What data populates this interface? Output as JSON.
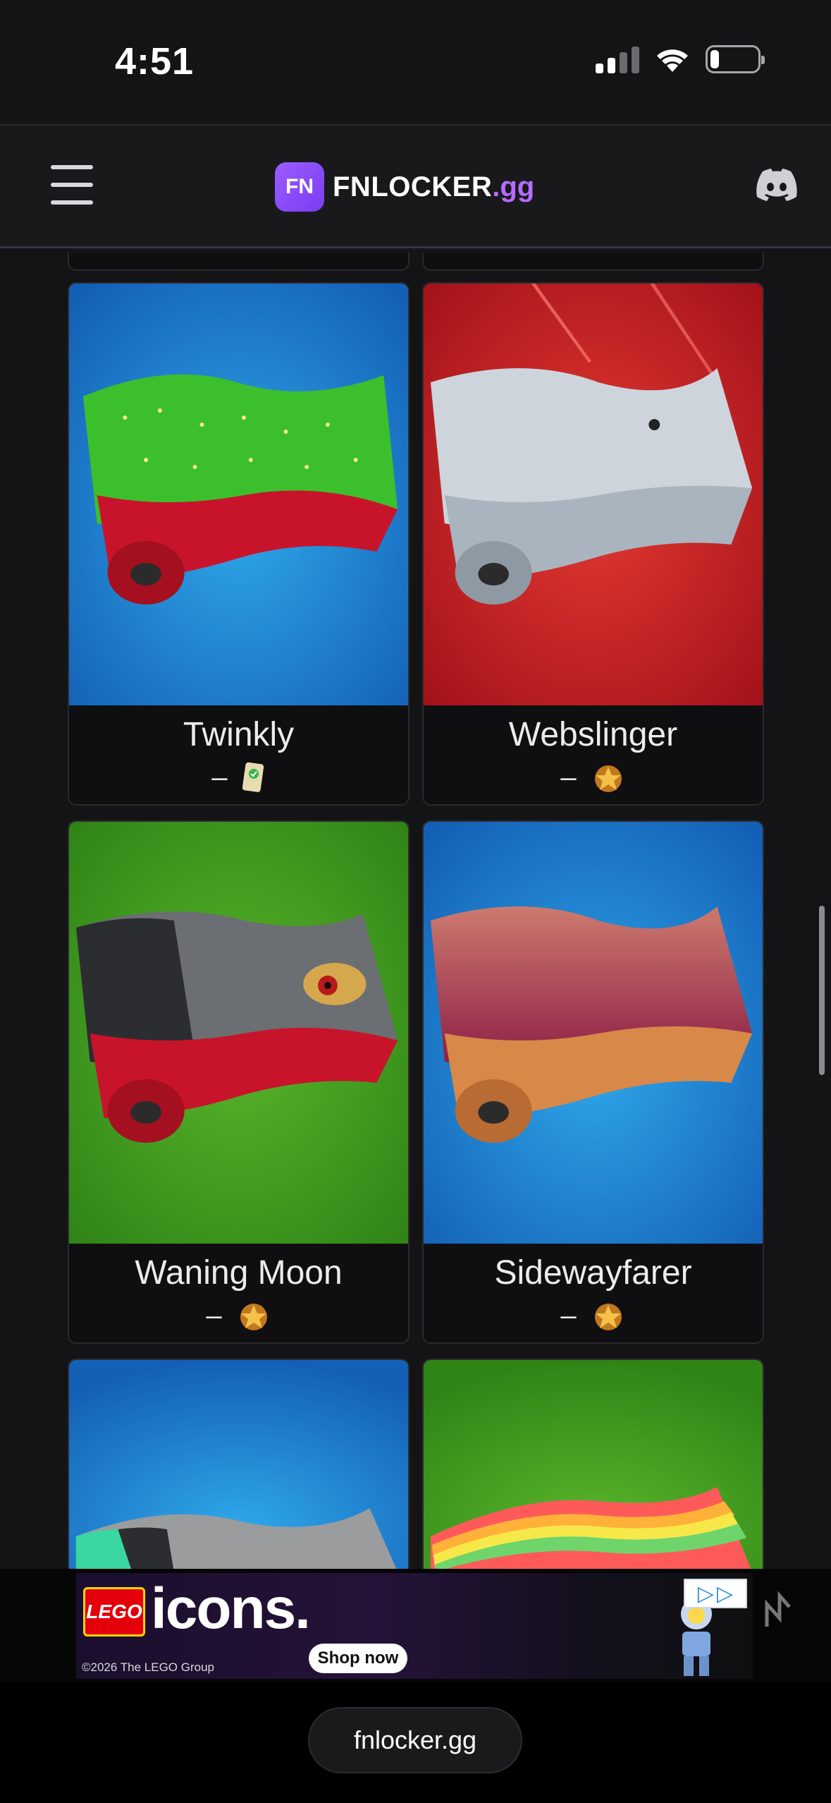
{
  "status_bar": {
    "time": "4:51"
  },
  "nav": {
    "brand_badge": "FN",
    "brand_name": "FNLOCKER",
    "brand_tld": ".gg"
  },
  "cards": [
    {
      "title": "Twinkly",
      "dash": "–",
      "source_icon": "paper-card-icon"
    },
    {
      "title": "Webslinger",
      "dash": "–",
      "source_icon": "battle-star-icon"
    },
    {
      "title": "Waning Moon",
      "dash": "–",
      "source_icon": "battle-star-icon"
    },
    {
      "title": "Sidewayfarer",
      "dash": "–",
      "source_icon": "battle-star-icon"
    }
  ],
  "ad": {
    "brand": "LEGO",
    "headline": "icons.",
    "copyright": "©2026 The LEGO Group",
    "cta": "Shop now"
  },
  "url_bar": {
    "url": "fnlocker.gg"
  },
  "colors": {
    "accent": "#b56cff",
    "background": "#141416",
    "card_bg": "#0f0f11"
  }
}
